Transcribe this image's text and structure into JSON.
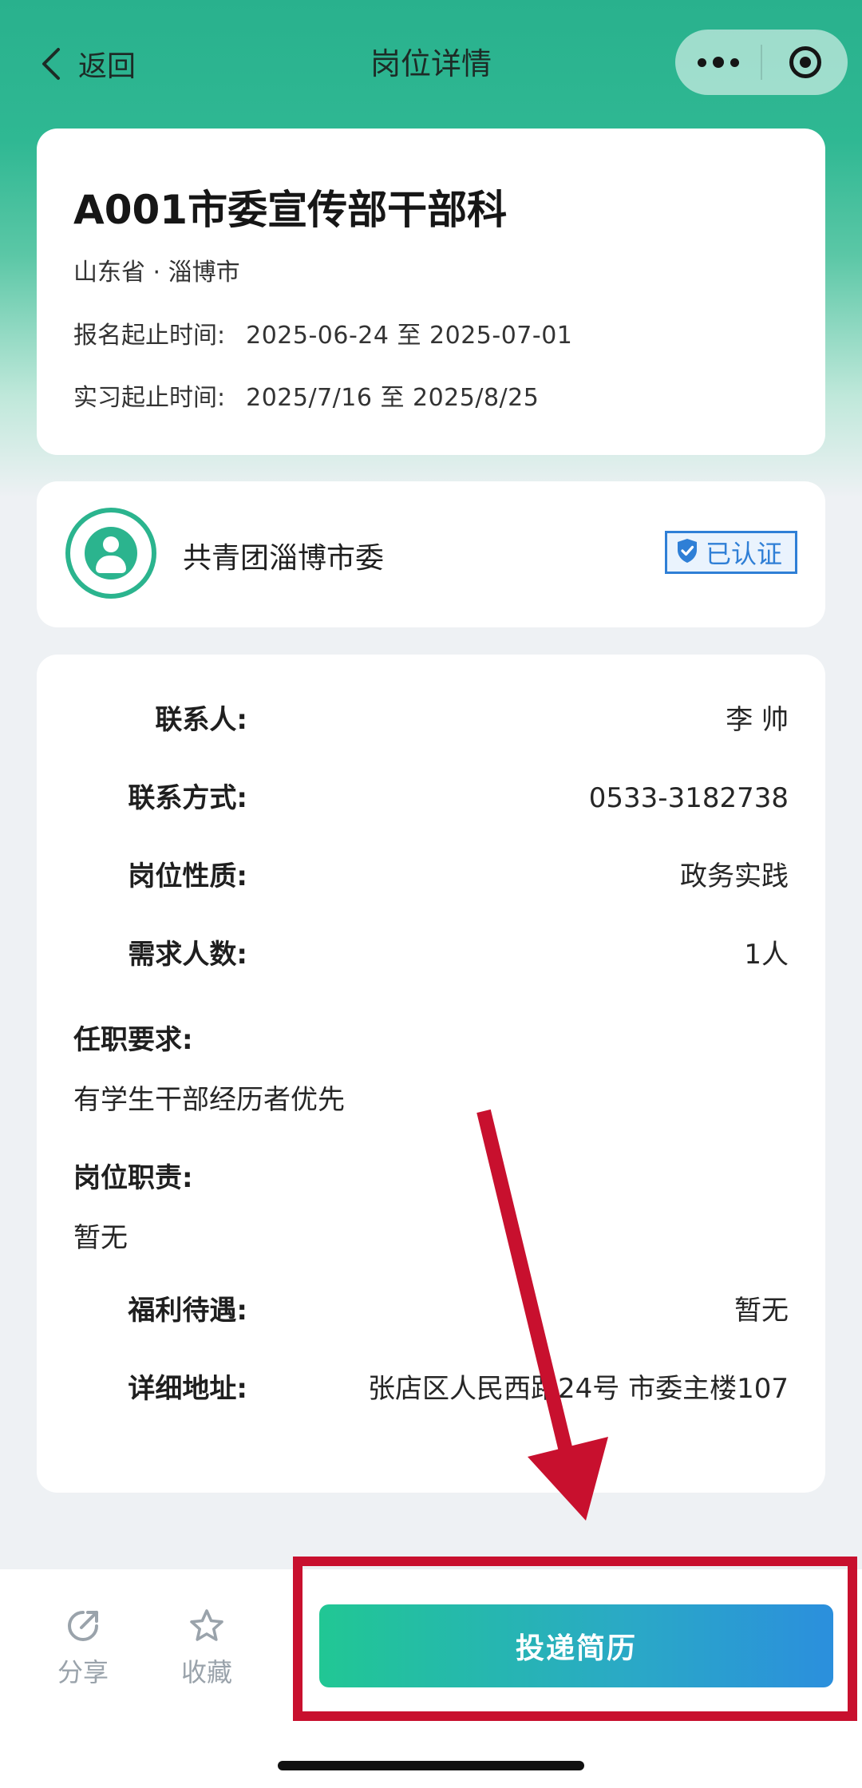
{
  "nav": {
    "back_label": "返回",
    "title": "岗位详情"
  },
  "job": {
    "title": "A001市委宣传部干部科",
    "location": "山东省 · 淄博市",
    "signup_label": "报名起止时间:",
    "signup_value": "2025-06-24 至 2025-07-01",
    "intern_label": "实习起止时间:",
    "intern_value": "2025/7/16 至 2025/8/25"
  },
  "org": {
    "name": "共青团淄博市委",
    "verified_label": "已认证"
  },
  "details": {
    "contact_person_label": "联系人:",
    "contact_person_value": "李 帅",
    "contact_method_label": "联系方式:",
    "contact_method_value": "0533-3182738",
    "nature_label": "岗位性质:",
    "nature_value": "政务实践",
    "headcount_label": "需求人数:",
    "headcount_value": "1人",
    "requirements_label": "任职要求:",
    "requirements_value": "有学生干部经历者优先",
    "duties_label": "岗位职责:",
    "duties_value": "暂无",
    "benefits_label": "福利待遇:",
    "benefits_value": "暂无",
    "address_label": "详细地址:",
    "address_value": "张店区人民西路24号 市委主楼107"
  },
  "bottom_bar": {
    "share_label": "分享",
    "favorite_label": "收藏",
    "apply_label": "投递简历"
  },
  "colors": {
    "brand_green": "#2bb48e",
    "verified_blue": "#2f7fd6",
    "annotation_red": "#c8102e"
  }
}
